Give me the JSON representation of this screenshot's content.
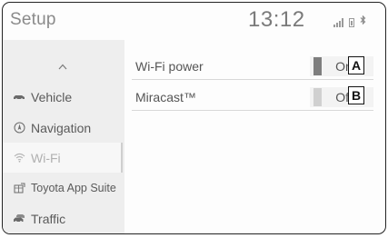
{
  "header": {
    "title": "Setup",
    "clock": "13:12"
  },
  "sidebar": {
    "scroll_up": "^",
    "items": [
      {
        "label": "Vehicle",
        "icon": "car-icon",
        "selected": false
      },
      {
        "label": "Navigation",
        "icon": "navigation-icon",
        "selected": false
      },
      {
        "label": "Wi-Fi",
        "icon": "wifi-icon",
        "selected": true
      },
      {
        "label": "Toyota App Suite",
        "icon": "app-suite-icon",
        "selected": false
      },
      {
        "label": "Traffic",
        "icon": "traffic-icon",
        "selected": false
      }
    ]
  },
  "settings": [
    {
      "label": "Wi-Fi power",
      "value": "On",
      "callout": "A",
      "indicator_color": "#7e7e7e"
    },
    {
      "label": "Miracast™",
      "value": "Off",
      "callout": "B",
      "indicator_color": "#d0d0d0"
    }
  ]
}
